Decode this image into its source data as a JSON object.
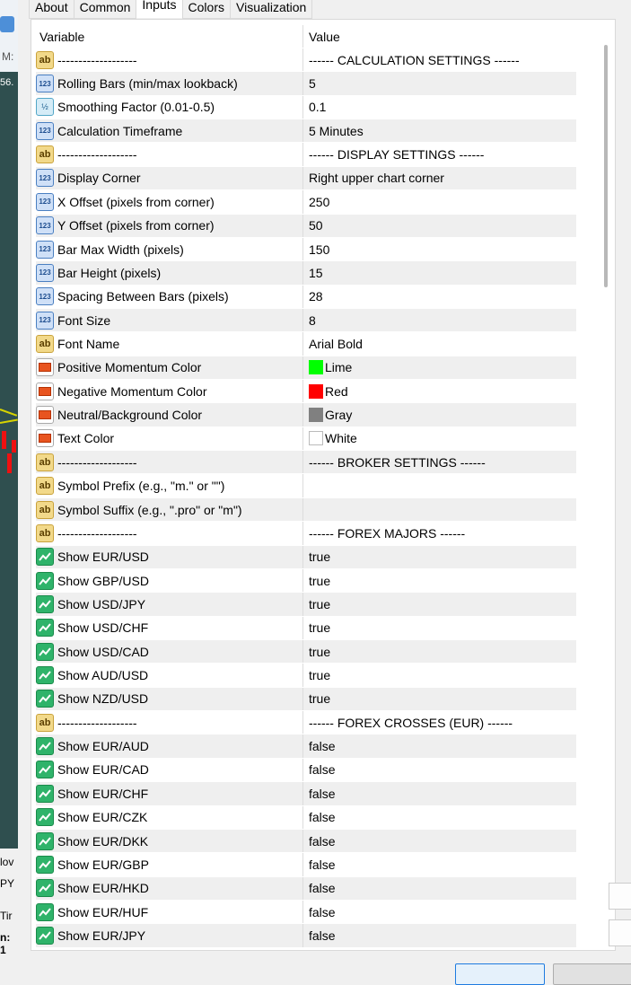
{
  "tabs": [
    "About",
    "Common",
    "Inputs",
    "Colors",
    "Visualization"
  ],
  "active_tab": "Inputs",
  "columns": {
    "variable": "Variable",
    "value": "Value"
  },
  "rows": [
    {
      "type": "ab",
      "name": "-------------------",
      "value": "------ CALCULATION SETTINGS ------"
    },
    {
      "type": "int",
      "name": "Rolling Bars (min/max lookback)",
      "value": "5"
    },
    {
      "type": "dbl",
      "name": "Smoothing Factor (0.01-0.5)",
      "value": "0.1"
    },
    {
      "type": "int",
      "name": "Calculation Timeframe",
      "value": "5 Minutes"
    },
    {
      "type": "ab",
      "name": "-------------------",
      "value": "------ DISPLAY SETTINGS ------"
    },
    {
      "type": "int",
      "name": "Display Corner",
      "value": "Right upper chart corner"
    },
    {
      "type": "int",
      "name": "X Offset (pixels from corner)",
      "value": "250"
    },
    {
      "type": "int",
      "name": "Y Offset (pixels from corner)",
      "value": "50"
    },
    {
      "type": "int",
      "name": "Bar Max Width (pixels)",
      "value": "150"
    },
    {
      "type": "int",
      "name": "Bar Height (pixels)",
      "value": "15"
    },
    {
      "type": "int",
      "name": "Spacing Between Bars (pixels)",
      "value": "28"
    },
    {
      "type": "int",
      "name": "Font Size",
      "value": "8"
    },
    {
      "type": "ab",
      "name": "Font Name",
      "value": "Arial Bold"
    },
    {
      "type": "col",
      "name": "Positive Momentum Color",
      "value": "Lime",
      "swatch": "#00ff00"
    },
    {
      "type": "col",
      "name": "Negative Momentum Color",
      "value": "Red",
      "swatch": "#ff0000"
    },
    {
      "type": "col",
      "name": "Neutral/Background Color",
      "value": "Gray",
      "swatch": "#808080"
    },
    {
      "type": "col",
      "name": "Text Color",
      "value": "White",
      "swatch": "#ffffff"
    },
    {
      "type": "ab",
      "name": "-------------------",
      "value": "------ BROKER SETTINGS ------"
    },
    {
      "type": "ab",
      "name": "Symbol Prefix (e.g., \"m.\" or \"\")",
      "value": ""
    },
    {
      "type": "ab",
      "name": "Symbol Suffix (e.g., \".pro\" or \"m\")",
      "value": ""
    },
    {
      "type": "ab",
      "name": "-------------------",
      "value": "------ FOREX MAJORS ------"
    },
    {
      "type": "bool",
      "name": "Show EUR/USD",
      "value": "true"
    },
    {
      "type": "bool",
      "name": "Show GBP/USD",
      "value": "true"
    },
    {
      "type": "bool",
      "name": "Show USD/JPY",
      "value": "true"
    },
    {
      "type": "bool",
      "name": "Show USD/CHF",
      "value": "true"
    },
    {
      "type": "bool",
      "name": "Show USD/CAD",
      "value": "true"
    },
    {
      "type": "bool",
      "name": "Show AUD/USD",
      "value": "true"
    },
    {
      "type": "bool",
      "name": "Show NZD/USD",
      "value": "true"
    },
    {
      "type": "ab",
      "name": "-------------------",
      "value": "------ FOREX CROSSES (EUR) ------"
    },
    {
      "type": "bool",
      "name": "Show EUR/AUD",
      "value": "false"
    },
    {
      "type": "bool",
      "name": "Show EUR/CAD",
      "value": "false"
    },
    {
      "type": "bool",
      "name": "Show EUR/CHF",
      "value": "false"
    },
    {
      "type": "bool",
      "name": "Show EUR/CZK",
      "value": "false"
    },
    {
      "type": "bool",
      "name": "Show EUR/DKK",
      "value": "false"
    },
    {
      "type": "bool",
      "name": "Show EUR/GBP",
      "value": "false"
    },
    {
      "type": "bool",
      "name": "Show EUR/HKD",
      "value": "false"
    },
    {
      "type": "bool",
      "name": "Show EUR/HUF",
      "value": "false"
    },
    {
      "type": "bool",
      "name": "Show EUR/JPY",
      "value": "false"
    }
  ],
  "background": {
    "left_texts": [
      "M:",
      "56.",
      "lov",
      "PY",
      "Tir",
      "n: 1"
    ]
  },
  "icons": {
    "ab": "string-type-icon",
    "int": "integer-type-icon",
    "dbl": "double-type-icon",
    "col": "color-type-icon",
    "bool": "boolean-type-icon"
  }
}
